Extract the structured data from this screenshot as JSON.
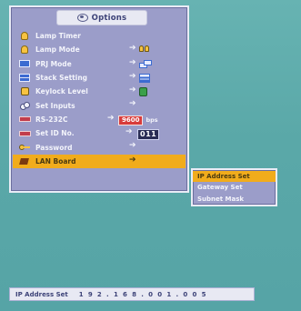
{
  "osd": {
    "title": "Options",
    "menu_items": [
      {
        "label": "Lamp Timer",
        "icon": "lamp-timer-icon",
        "arrow": "",
        "extra": ""
      },
      {
        "label": "Lamp Mode",
        "icon": "lamp-mode-icon",
        "arrow": "➔",
        "extra": "lamps"
      },
      {
        "label": "PRJ Mode",
        "icon": "prj-mode-icon",
        "arrow": "➔",
        "extra": "screens"
      },
      {
        "label": "Stack Setting",
        "icon": "stack-setting-icon",
        "arrow": "➔",
        "extra": "stack"
      },
      {
        "label": "Keylock Level",
        "icon": "keylock-icon",
        "arrow": "➔",
        "extra": "lock"
      },
      {
        "label": "Set Inputs",
        "icon": "set-inputs-icon",
        "arrow": "➔",
        "extra": ""
      },
      {
        "label": "RS-232C",
        "icon": "rs232c-icon",
        "arrow": "➔",
        "extra": "baud"
      },
      {
        "label": "Set ID No.",
        "icon": "set-id-icon",
        "arrow": "➔",
        "extra": "id"
      },
      {
        "label": "Password",
        "icon": "password-icon",
        "arrow": "➔",
        "extra": ""
      },
      {
        "label": "LAN Board",
        "icon": "lan-board-icon",
        "arrow": "➔",
        "extra": "",
        "selected": true
      }
    ],
    "rs232c_baud": "9600",
    "rs232c_unit": "bps",
    "id_value": "011"
  },
  "submenu": {
    "items": [
      {
        "label": "IP Address Set",
        "selected": true
      },
      {
        "label": "Gateway Set",
        "selected": false
      },
      {
        "label": "Subnet Mask",
        "selected": false
      }
    ]
  },
  "status": {
    "label": "IP Address Set",
    "value": "1 9 2 . 1 6 8 . 0 0 1 . 0 0 5"
  },
  "colors": {
    "background": "#5aa9a9",
    "menu_bg": "#9b9dc9",
    "highlight": "#f1ac1c"
  }
}
